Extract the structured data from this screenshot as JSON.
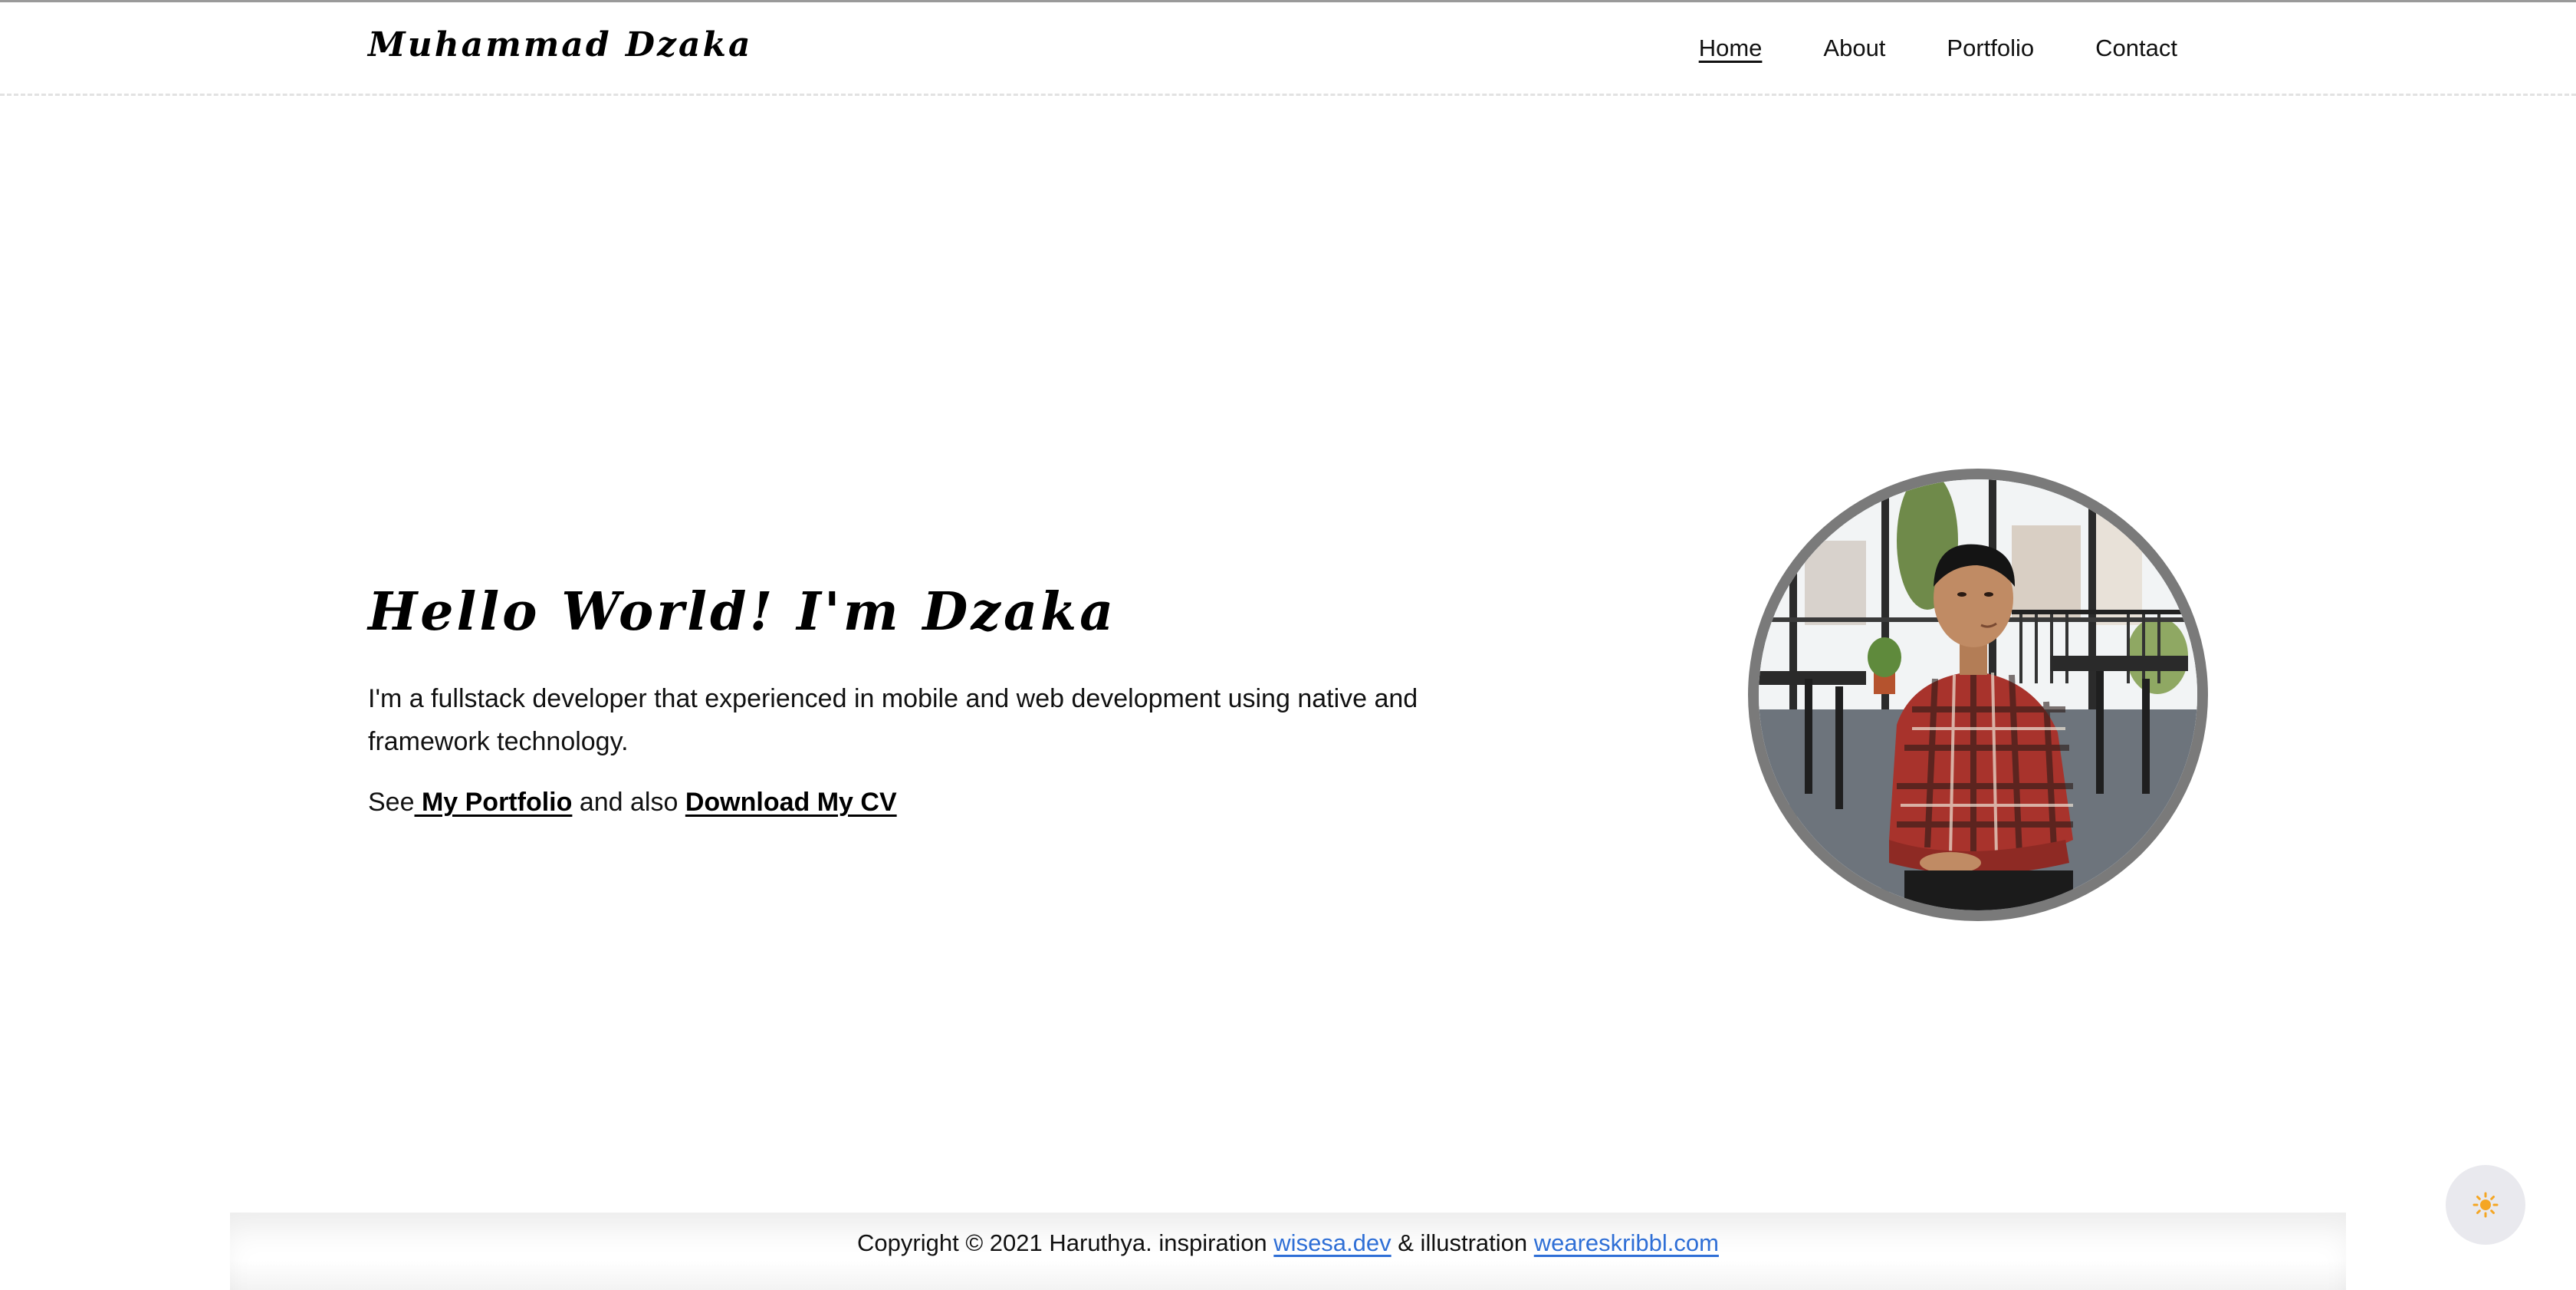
{
  "header": {
    "brand": "Muhammad Dzaka",
    "nav": [
      {
        "label": "Home",
        "active": true
      },
      {
        "label": "About",
        "active": false
      },
      {
        "label": "Portfolio",
        "active": false
      },
      {
        "label": "Contact",
        "active": false
      }
    ]
  },
  "hero": {
    "title": "Hello World! I'm Dzaka",
    "description": "I'm a fullstack developer that experienced in mobile and web development using native and framework technology.",
    "links_prefix": "See",
    "portfolio_link": " My Portfolio",
    "links_middle": " and also ",
    "cv_link": "Download My CV"
  },
  "footer": {
    "copyright": "Copyright © 2021 Haruthya. inspiration ",
    "link1": "wisesa.dev",
    "middle": " & illustration ",
    "link2": "weareskribbl.com",
    "link_color": "#2f6fd6"
  },
  "theme_toggle": {
    "icon": "sun-icon",
    "icon_color": "#f5a623"
  }
}
